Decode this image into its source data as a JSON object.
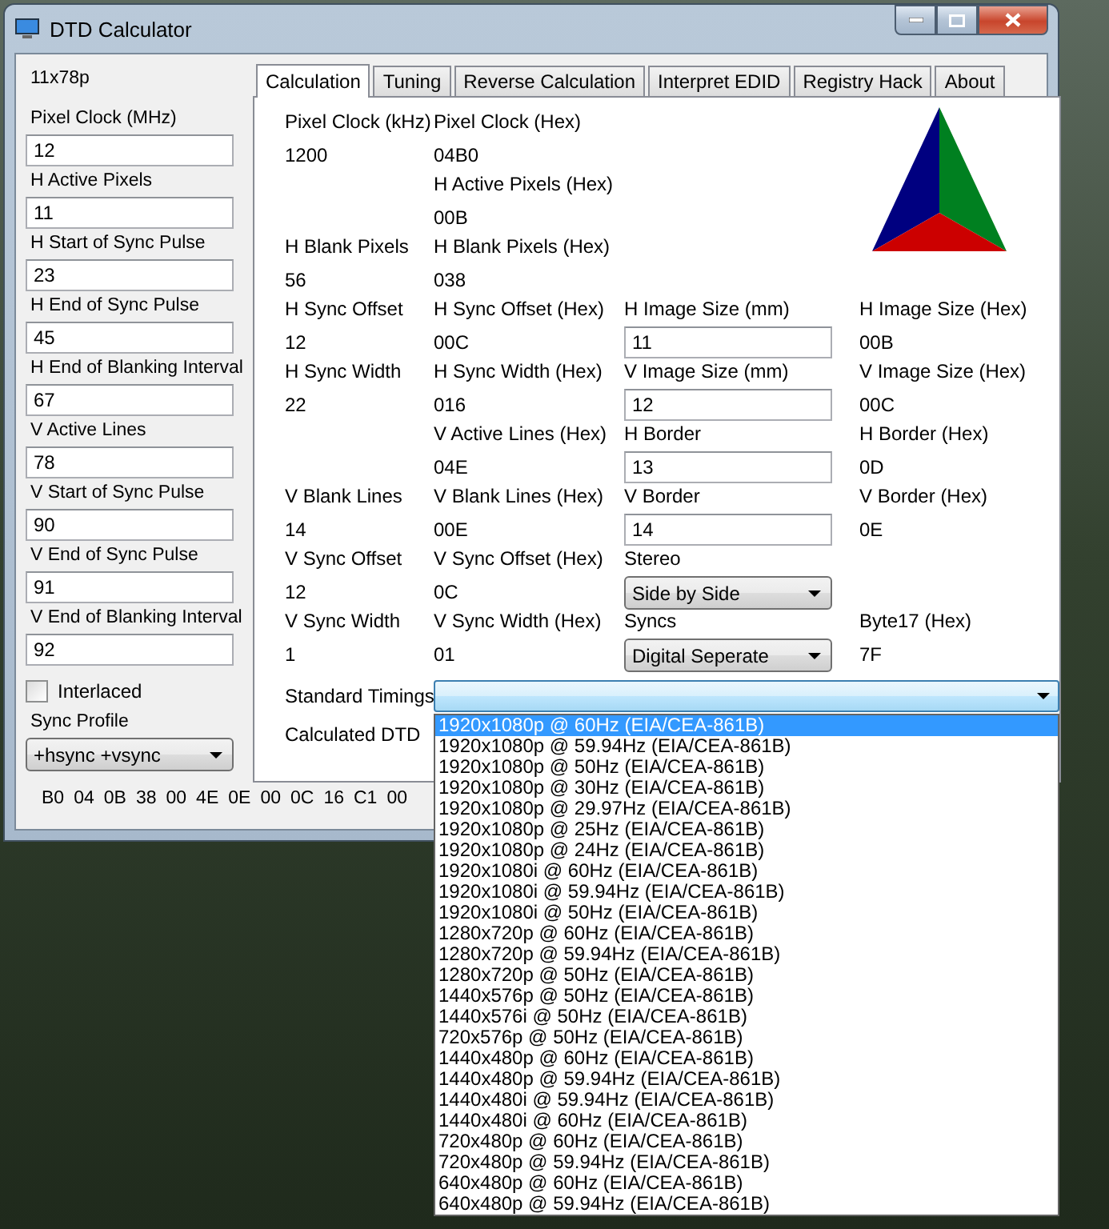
{
  "window": {
    "title": "DTD Calculator"
  },
  "sidebar": {
    "mode_label": "11x78p",
    "fields": [
      {
        "label": "Pixel Clock (MHz)",
        "value": "12"
      },
      {
        "label": "H Active Pixels",
        "value": "11"
      },
      {
        "label": "H Start of Sync Pulse",
        "value": "23"
      },
      {
        "label": "H End of Sync Pulse",
        "value": "45"
      },
      {
        "label": "H End of Blanking Interval",
        "value": "67"
      },
      {
        "label": "V Active Lines",
        "value": "78"
      },
      {
        "label": "V Start of Sync Pulse",
        "value": "90"
      },
      {
        "label": "V End of Sync Pulse",
        "value": "91"
      },
      {
        "label": "V End of Blanking Interval",
        "value": "92"
      }
    ],
    "interlaced": {
      "label": "Interlaced",
      "checked": false
    },
    "sync_profile": {
      "label": "Sync Profile",
      "value": "+hsync +vsync"
    }
  },
  "tabs": [
    {
      "label": "Calculation",
      "selected": true
    },
    {
      "label": "Tuning",
      "selected": false
    },
    {
      "label": "Reverse Calculation",
      "selected": false
    },
    {
      "label": "Interpret EDID",
      "selected": false
    },
    {
      "label": "Registry Hack",
      "selected": false
    },
    {
      "label": "About",
      "selected": false
    }
  ],
  "calculation": {
    "rows": [
      [
        {
          "kind": "text",
          "label": "Pixel Clock (kHz)",
          "value": "1200"
        },
        {
          "kind": "text",
          "label": "Pixel Clock (Hex)",
          "value": "04B0"
        },
        {
          "kind": "empty"
        },
        {
          "kind": "empty"
        }
      ],
      [
        {
          "kind": "empty"
        },
        {
          "kind": "text",
          "label": "H Active Pixels (Hex)",
          "value": "00B"
        },
        {
          "kind": "empty"
        },
        {
          "kind": "empty"
        }
      ],
      [
        {
          "kind": "text",
          "label": "H Blank Pixels",
          "value": "56"
        },
        {
          "kind": "text",
          "label": "H Blank Pixels (Hex)",
          "value": "038"
        },
        {
          "kind": "empty"
        },
        {
          "kind": "empty"
        }
      ],
      [
        {
          "kind": "text",
          "label": "H Sync Offset",
          "value": "12"
        },
        {
          "kind": "text",
          "label": "H Sync Offset (Hex)",
          "value": "00C"
        },
        {
          "kind": "input",
          "label": "H Image Size (mm)",
          "value": "11"
        },
        {
          "kind": "text",
          "label": "H Image Size (Hex)",
          "value": "00B"
        }
      ],
      [
        {
          "kind": "text",
          "label": "H Sync Width",
          "value": "22"
        },
        {
          "kind": "text",
          "label": "H Sync Width (Hex)",
          "value": "016"
        },
        {
          "kind": "input",
          "label": "V Image Size (mm)",
          "value": "12"
        },
        {
          "kind": "text",
          "label": "V Image Size (Hex)",
          "value": "00C"
        }
      ],
      [
        {
          "kind": "empty"
        },
        {
          "kind": "text",
          "label": "V Active Lines (Hex)",
          "value": "04E"
        },
        {
          "kind": "input",
          "label": "H Border",
          "value": "13"
        },
        {
          "kind": "text",
          "label": "H Border (Hex)",
          "value": "0D"
        }
      ],
      [
        {
          "kind": "text",
          "label": "V Blank Lines",
          "value": "14"
        },
        {
          "kind": "text",
          "label": "V Blank Lines (Hex)",
          "value": "00E"
        },
        {
          "kind": "input",
          "label": "V Border",
          "value": "14"
        },
        {
          "kind": "text",
          "label": "V Border (Hex)",
          "value": "0E"
        }
      ],
      [
        {
          "kind": "text",
          "label": "V Sync Offset",
          "value": "12"
        },
        {
          "kind": "text",
          "label": "V Sync Offset (Hex)",
          "value": "0C"
        },
        {
          "kind": "select",
          "label": "Stereo",
          "value": "Side by Side"
        },
        {
          "kind": "empty"
        }
      ],
      [
        {
          "kind": "text",
          "label": "V Sync Width",
          "value": "1"
        },
        {
          "kind": "text",
          "label": "V Sync Width (Hex)",
          "value": "01"
        },
        {
          "kind": "select",
          "label": "Syncs",
          "value": "Digital Seperate"
        },
        {
          "kind": "text",
          "label": "Byte17 (Hex)",
          "value": "7F"
        }
      ]
    ],
    "standard_timings": {
      "label": "Standard Timings",
      "expanded": true,
      "options": [
        {
          "label": "1920x1080p @ 60Hz (EIA/CEA-861B)",
          "selected": true
        },
        {
          "label": "1920x1080p @ 59.94Hz (EIA/CEA-861B)",
          "selected": false
        },
        {
          "label": "1920x1080p @ 50Hz (EIA/CEA-861B)",
          "selected": false
        },
        {
          "label": "1920x1080p @ 30Hz (EIA/CEA-861B)",
          "selected": false
        },
        {
          "label": "1920x1080p @ 29.97Hz (EIA/CEA-861B)",
          "selected": false
        },
        {
          "label": "1920x1080p @ 25Hz (EIA/CEA-861B)",
          "selected": false
        },
        {
          "label": "1920x1080p @ 24Hz (EIA/CEA-861B)",
          "selected": false
        },
        {
          "label": "1920x1080i @ 60Hz (EIA/CEA-861B)",
          "selected": false
        },
        {
          "label": "1920x1080i @ 59.94Hz (EIA/CEA-861B)",
          "selected": false
        },
        {
          "label": "1920x1080i @ 50Hz (EIA/CEA-861B)",
          "selected": false
        },
        {
          "label": "1280x720p @ 60Hz (EIA/CEA-861B)",
          "selected": false
        },
        {
          "label": "1280x720p @ 59.94Hz (EIA/CEA-861B)",
          "selected": false
        },
        {
          "label": "1280x720p @ 50Hz (EIA/CEA-861B)",
          "selected": false
        },
        {
          "label": "1440x576p @ 50Hz (EIA/CEA-861B)",
          "selected": false
        },
        {
          "label": "1440x576i @ 50Hz (EIA/CEA-861B)",
          "selected": false
        },
        {
          "label": "720x576p @ 50Hz (EIA/CEA-861B)",
          "selected": false
        },
        {
          "label": "1440x480p @ 60Hz (EIA/CEA-861B)",
          "selected": false
        },
        {
          "label": "1440x480p @ 59.94Hz (EIA/CEA-861B)",
          "selected": false
        },
        {
          "label": "1440x480i @ 59.94Hz (EIA/CEA-861B)",
          "selected": false
        },
        {
          "label": "1440x480i @ 60Hz (EIA/CEA-861B)",
          "selected": false
        },
        {
          "label": "720x480p @ 60Hz (EIA/CEA-861B)",
          "selected": false
        },
        {
          "label": "720x480p @ 59.94Hz (EIA/CEA-861B)",
          "selected": false
        },
        {
          "label": "640x480p @ 60Hz (EIA/CEA-861B)",
          "selected": false
        },
        {
          "label": "640x480p @ 59.94Hz (EIA/CEA-861B)",
          "selected": false
        }
      ]
    },
    "calculated_dtd": {
      "label": "Calculated DTD"
    }
  },
  "dtd_bytes": [
    "B0",
    "04",
    "0B",
    "38",
    "00",
    "4E",
    "0E",
    "00",
    "0C",
    "16",
    "C1",
    "00"
  ]
}
